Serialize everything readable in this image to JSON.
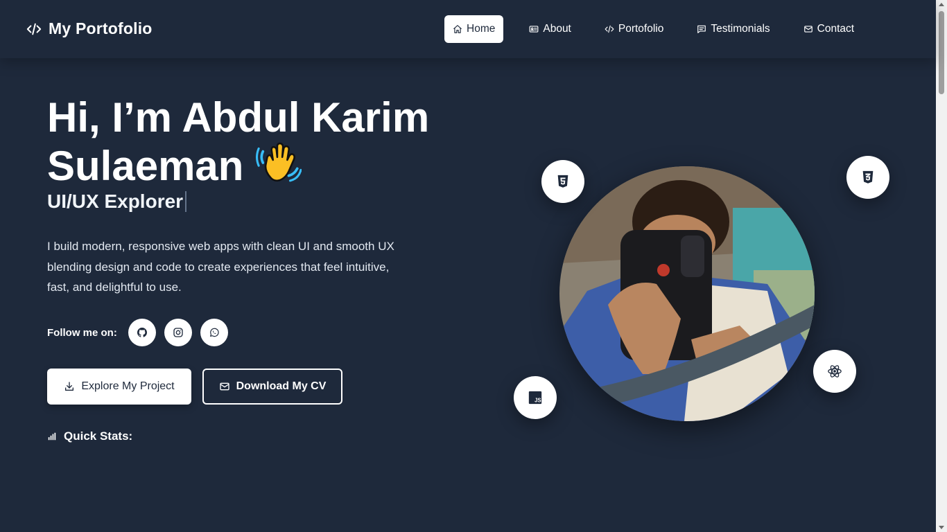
{
  "brand": {
    "title": "My Portofolio"
  },
  "nav": {
    "items": [
      {
        "label": "Home",
        "icon": "home-icon",
        "active": true
      },
      {
        "label": "About",
        "icon": "id-card-icon"
      },
      {
        "label": "Portofolio",
        "icon": "code-icon"
      },
      {
        "label": "Testimonials",
        "icon": "message-icon"
      },
      {
        "label": "Contact",
        "icon": "mail-icon"
      }
    ]
  },
  "hero": {
    "title_line1": "Hi, I’m Abdul Karim",
    "title_line2": "Sulaeman",
    "subtitle": "UI/UX Explorer",
    "description": "I build modern, responsive web apps with clean UI and smooth UX blending design and code to create experiences that feel intuitive, fast, and delightful to use.",
    "follow_label": "Follow me on:",
    "socials": [
      "github-icon",
      "instagram-icon",
      "whatsapp-icon"
    ],
    "primary_button": "Explore My Project",
    "secondary_button": "Download My CV",
    "stats_label": "Quick Stats:"
  },
  "tech_badges": [
    "html5-icon",
    "css3-icon",
    "react-icon",
    "javascript-icon"
  ],
  "colors": {
    "background": "#1e293b",
    "foreground": "#ffffff",
    "button_text": "#1e293b"
  }
}
